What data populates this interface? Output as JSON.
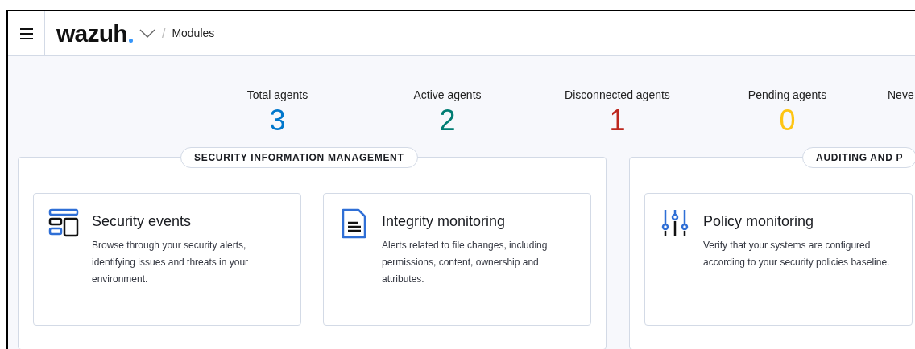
{
  "header": {
    "logo": "wazuh",
    "separator": "/",
    "breadcrumb": "Modules"
  },
  "stats": [
    {
      "label": "Total agents",
      "value": "3",
      "color": "#0077cc"
    },
    {
      "label": "Active agents",
      "value": "2",
      "color": "#017d73"
    },
    {
      "label": "Disconnected agents",
      "value": "1",
      "color": "#bd271e"
    },
    {
      "label": "Pending agents",
      "value": "0",
      "color": "#fec514"
    },
    {
      "label": "Neve"
    }
  ],
  "sections": [
    {
      "title": "SECURITY INFORMATION MANAGEMENT",
      "cards": [
        {
          "kind": "events",
          "title": "Security events",
          "description": "Browse through your security alerts, identifying issues and threats in your environment."
        },
        {
          "kind": "document",
          "title": "Integrity monitoring",
          "description": "Alerts related to file changes, including permissions, content, ownership and attributes."
        }
      ]
    },
    {
      "title": "AUDITING AND P",
      "cards": [
        {
          "kind": "sliders",
          "title": "Policy monitoring",
          "description": "Verify that your systems are configured according to your security policies baseline."
        }
      ]
    }
  ]
}
